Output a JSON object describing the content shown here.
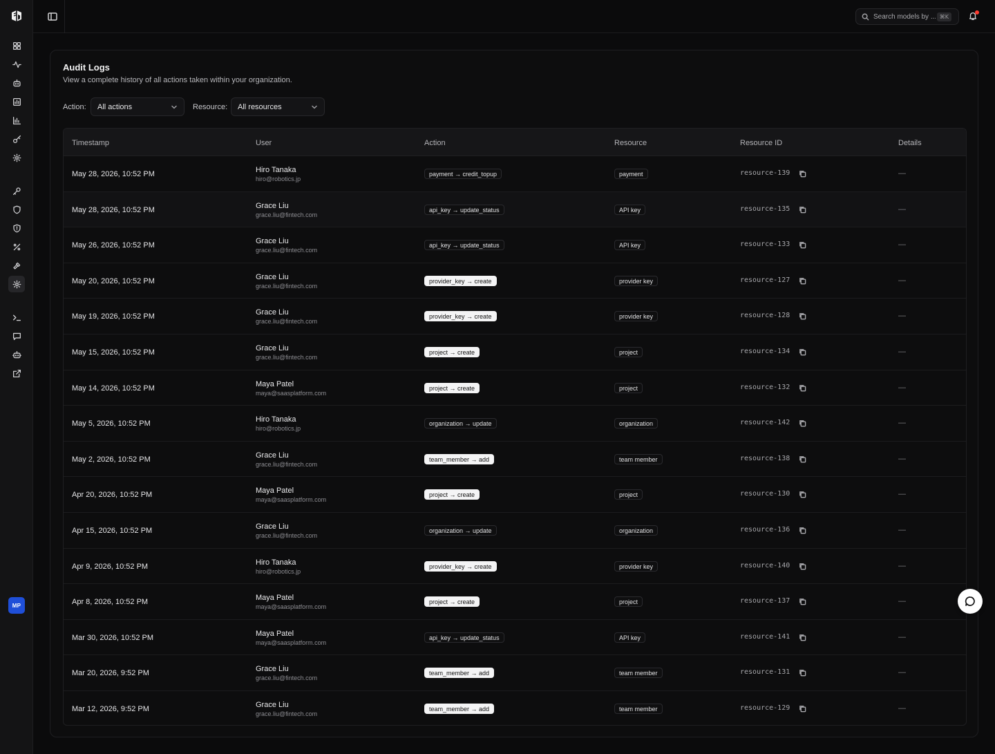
{
  "sidebar": {
    "avatar_initials": "MP",
    "icons": [
      "dashboard-icon",
      "activity-icon",
      "bot-icon",
      "usage-icon",
      "bar-chart-icon",
      "keys-icon",
      "settings-icon",
      "key-icon",
      "shield-icon",
      "shield-alert-icon",
      "percent-icon",
      "hammer-icon",
      "organization-settings-icon",
      "terminal-icon",
      "message-icon",
      "agent-icon",
      "external-link-icon"
    ]
  },
  "topbar": {
    "search_placeholder": "Search models by ...",
    "search_shortcut": "⌘K"
  },
  "page": {
    "title": "Audit Logs",
    "subtitle": "View a complete history of all actions taken within your organization."
  },
  "filters": {
    "action_label": "Action:",
    "action_value": "All actions",
    "resource_label": "Resource:",
    "resource_value": "All resources"
  },
  "table": {
    "headers": [
      "Timestamp",
      "User",
      "Action",
      "Resource",
      "Resource ID",
      "Details"
    ],
    "rows": [
      {
        "timestamp": "May 28, 2026, 10:52 PM",
        "user": "Hiro Tanaka",
        "email": "hiro@robotics.jp",
        "action": "payment → credit_topup",
        "action_style": "dark",
        "resource": "payment",
        "resource_id": "resource-139",
        "details": "—"
      },
      {
        "timestamp": "May 28, 2026, 10:52 PM",
        "user": "Grace Liu",
        "email": "grace.liu@fintech.com",
        "action": "api_key → update_status",
        "action_style": "dark",
        "resource": "API key",
        "resource_id": "resource-135",
        "details": "—"
      },
      {
        "timestamp": "May 26, 2026, 10:52 PM",
        "user": "Grace Liu",
        "email": "grace.liu@fintech.com",
        "action": "api_key → update_status",
        "action_style": "dark",
        "resource": "API key",
        "resource_id": "resource-133",
        "details": "—"
      },
      {
        "timestamp": "May 20, 2026, 10:52 PM",
        "user": "Grace Liu",
        "email": "grace.liu@fintech.com",
        "action": "provider_key → create",
        "action_style": "light",
        "resource": "provider key",
        "resource_id": "resource-127",
        "details": "—"
      },
      {
        "timestamp": "May 19, 2026, 10:52 PM",
        "user": "Grace Liu",
        "email": "grace.liu@fintech.com",
        "action": "provider_key → create",
        "action_style": "light",
        "resource": "provider key",
        "resource_id": "resource-128",
        "details": "—"
      },
      {
        "timestamp": "May 15, 2026, 10:52 PM",
        "user": "Grace Liu",
        "email": "grace.liu@fintech.com",
        "action": "project → create",
        "action_style": "light",
        "resource": "project",
        "resource_id": "resource-134",
        "details": "—"
      },
      {
        "timestamp": "May 14, 2026, 10:52 PM",
        "user": "Maya Patel",
        "email": "maya@saasplatform.com",
        "action": "project → create",
        "action_style": "light",
        "resource": "project",
        "resource_id": "resource-132",
        "details": "—"
      },
      {
        "timestamp": "May 5, 2026, 10:52 PM",
        "user": "Hiro Tanaka",
        "email": "hiro@robotics.jp",
        "action": "organization → update",
        "action_style": "dark",
        "resource": "organization",
        "resource_id": "resource-142",
        "details": "—"
      },
      {
        "timestamp": "May 2, 2026, 10:52 PM",
        "user": "Grace Liu",
        "email": "grace.liu@fintech.com",
        "action": "team_member → add",
        "action_style": "light",
        "resource": "team member",
        "resource_id": "resource-138",
        "details": "—"
      },
      {
        "timestamp": "Apr 20, 2026, 10:52 PM",
        "user": "Maya Patel",
        "email": "maya@saasplatform.com",
        "action": "project → create",
        "action_style": "light",
        "resource": "project",
        "resource_id": "resource-130",
        "details": "—"
      },
      {
        "timestamp": "Apr 15, 2026, 10:52 PM",
        "user": "Grace Liu",
        "email": "grace.liu@fintech.com",
        "action": "organization → update",
        "action_style": "dark",
        "resource": "organization",
        "resource_id": "resource-136",
        "details": "—"
      },
      {
        "timestamp": "Apr 9, 2026, 10:52 PM",
        "user": "Hiro Tanaka",
        "email": "hiro@robotics.jp",
        "action": "provider_key → create",
        "action_style": "light",
        "resource": "provider key",
        "resource_id": "resource-140",
        "details": "—"
      },
      {
        "timestamp": "Apr 8, 2026, 10:52 PM",
        "user": "Maya Patel",
        "email": "maya@saasplatform.com",
        "action": "project → create",
        "action_style": "light",
        "resource": "project",
        "resource_id": "resource-137",
        "details": "—"
      },
      {
        "timestamp": "Mar 30, 2026, 10:52 PM",
        "user": "Maya Patel",
        "email": "maya@saasplatform.com",
        "action": "api_key → update_status",
        "action_style": "dark",
        "resource": "API key",
        "resource_id": "resource-141",
        "details": "—"
      },
      {
        "timestamp": "Mar 20, 2026, 9:52 PM",
        "user": "Grace Liu",
        "email": "grace.liu@fintech.com",
        "action": "team_member → add",
        "action_style": "light",
        "resource": "team member",
        "resource_id": "resource-131",
        "details": "—"
      },
      {
        "timestamp": "Mar 12, 2026, 9:52 PM",
        "user": "Grace Liu",
        "email": "grace.liu@fintech.com",
        "action": "team_member → add",
        "action_style": "light",
        "resource": "team member",
        "resource_id": "resource-129",
        "details": "—"
      }
    ]
  }
}
